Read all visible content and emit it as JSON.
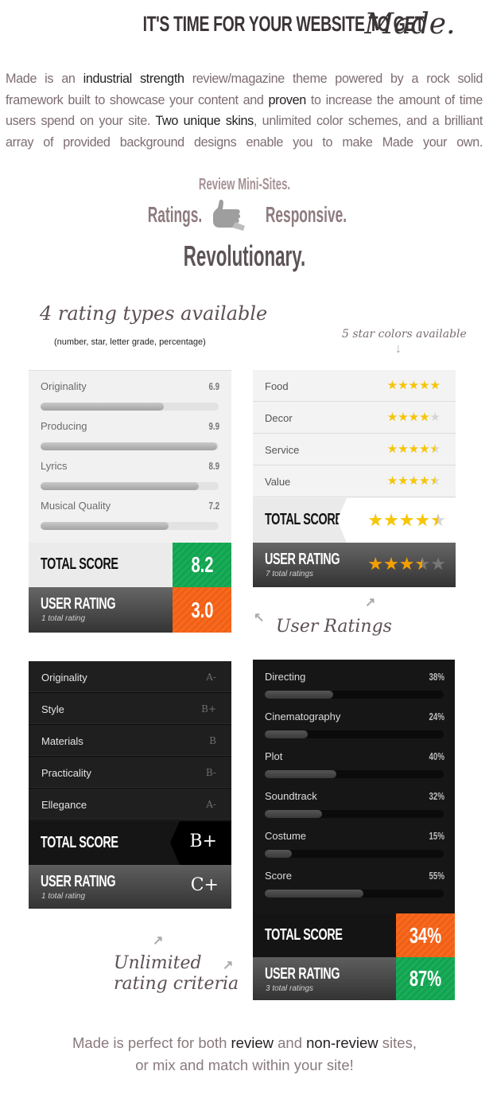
{
  "headline": {
    "caps": "IT'S TIME FOR YOUR WEBSITE TO GET",
    "script": "Made."
  },
  "intro": {
    "p1": "Made is an ",
    "h1": "industrial strength",
    "p2": " review/magazine theme powered by a rock solid framework built to showcase your content and ",
    "h2": "proven",
    "p3": " to increase the amount of time users spend on your site. ",
    "h3": "Two unique skins",
    "p4": ", unlimited color schemes, and a brilliant array of provided background designs enable you to make Made your own."
  },
  "taglines": {
    "mini_sites": "Review Mini-Sites.",
    "ratings": "Ratings.",
    "responsive": "Responsive.",
    "revolutionary": "Revolutionary."
  },
  "annotations": {
    "rating_types": "4 rating types available",
    "rating_types_sub": "(number, star, letter grade, percentage)",
    "star_colors": "5 star colors available",
    "user_ratings": "User Ratings",
    "unlimited_line1": "Unlimited",
    "unlimited_line2": "rating criteria"
  },
  "numeric_box": {
    "criteria": [
      {
        "label": "Originality",
        "value": "6.9",
        "fraction": 0.69
      },
      {
        "label": "Producing",
        "value": "9.9",
        "fraction": 0.99
      },
      {
        "label": "Lyrics",
        "value": "8.9",
        "fraction": 0.89
      },
      {
        "label": "Musical Quality",
        "value": "7.2",
        "fraction": 0.72
      }
    ],
    "total_label": "TOTAL SCORE",
    "total_value": "8.2",
    "user_label": "USER RATING",
    "user_count": "1 total rating",
    "user_value": "3.0",
    "colors": {
      "total": "#16a652",
      "user": "#f3641b"
    }
  },
  "star_box": {
    "criteria": [
      {
        "label": "Food",
        "stars": 5
      },
      {
        "label": "Decor",
        "stars": 4
      },
      {
        "label": "Service",
        "stars": 4.5
      },
      {
        "label": "Value",
        "stars": 4.5
      }
    ],
    "total_label": "TOTAL SCORE",
    "total_stars": 4.5,
    "user_label": "USER RATING",
    "user_count": "7 total ratings",
    "user_stars": 3.5,
    "colors": {
      "star": "#f7c600",
      "user_star": "#f59e00"
    }
  },
  "grade_box": {
    "criteria": [
      {
        "label": "Originality",
        "grade": "A-"
      },
      {
        "label": "Style",
        "grade": "B+"
      },
      {
        "label": "Materials",
        "grade": "B"
      },
      {
        "label": "Practicality",
        "grade": "B-"
      },
      {
        "label": "Ellegance",
        "grade": "A-"
      }
    ],
    "total_label": "TOTAL SCORE",
    "total_grade": "B+",
    "user_label": "USER RATING",
    "user_count": "1 total rating",
    "user_grade": "C+"
  },
  "percent_box": {
    "criteria": [
      {
        "label": "Directing",
        "value": "38%",
        "fraction": 0.38
      },
      {
        "label": "Cinematography",
        "value": "24%",
        "fraction": 0.24
      },
      {
        "label": "Plot",
        "value": "40%",
        "fraction": 0.4
      },
      {
        "label": "Soundtrack",
        "value": "32%",
        "fraction": 0.32
      },
      {
        "label": "Costume",
        "value": "15%",
        "fraction": 0.15
      },
      {
        "label": "Score",
        "value": "55%",
        "fraction": 0.55
      }
    ],
    "total_label": "TOTAL SCORE",
    "total_value": "34%",
    "user_label": "USER RATING",
    "user_count": "3 total ratings",
    "user_value": "87%",
    "colors": {
      "total": "#f3641b",
      "user": "#16a652"
    }
  },
  "outro": {
    "p1": "Made is perfect for both ",
    "h1": "review",
    "p2": " and ",
    "h2": "non-review",
    "p3": " sites,",
    "line2": "or mix and match within your site!"
  }
}
